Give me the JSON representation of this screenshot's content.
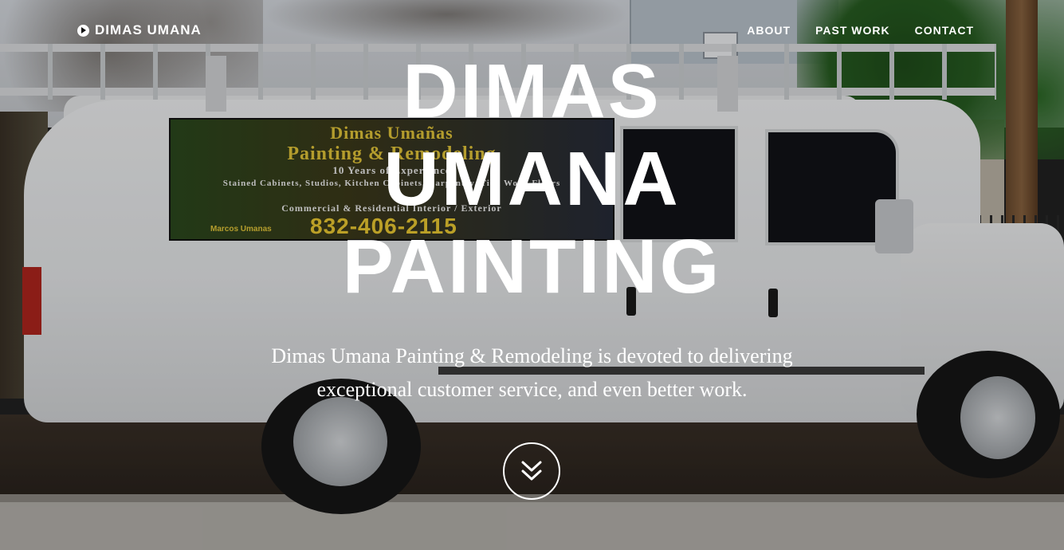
{
  "nav": {
    "brand_label": "DIMAS UMANA",
    "brand_icon": "play-circle-icon",
    "links": [
      {
        "label": "ABOUT"
      },
      {
        "label": "PAST WORK"
      },
      {
        "label": "CONTACT"
      }
    ]
  },
  "hero": {
    "title_lines": [
      "DIMAS",
      "UMANA",
      "PAINTING"
    ],
    "description_lines": [
      "Dimas Umana Painting & Remodeling is devoted to delivering",
      "exceptional customer service, and even better work."
    ],
    "scroll_icon": "double-chevron-down-icon"
  },
  "background_sign": {
    "line1": "Dimas Umañas",
    "line2": "Painting & Remodeling",
    "line3": "10 Years of Experience",
    "line4": "Stained Cabinets, Studios, Kitchen Cabinets, Carpentry, Tile, Wood Floors",
    "line5": "Commercial & Residential Interior / Exterior",
    "name": "Marcos Umanas",
    "phone": "832-406-2115"
  },
  "colors": {
    "text": "#ffffff",
    "overlay": "rgba(0,0,0,0.22)",
    "sign_text": "#e7c93a"
  }
}
